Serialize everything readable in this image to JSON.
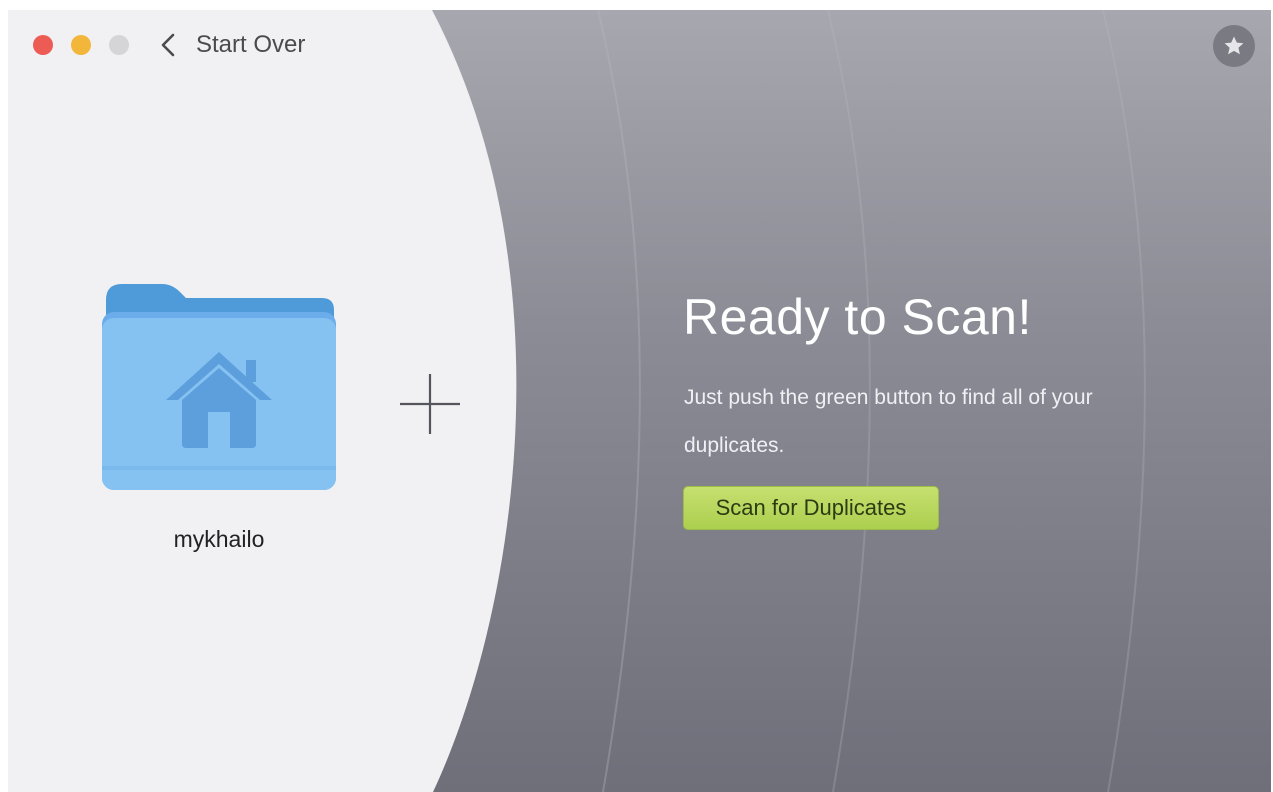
{
  "window": {
    "traffic_lights": [
      "close",
      "minimize",
      "zoom"
    ]
  },
  "toolbar": {
    "back_icon": "chevron-left-icon",
    "start_over_label": "Start Over",
    "star_icon": "star-icon"
  },
  "target": {
    "folder_icon": "home-folder-icon",
    "folder_name": "mykhailo",
    "add_icon": "plus-icon"
  },
  "main": {
    "headline": "Ready to Scan!",
    "subtext": "Just push the green button to find all of your duplicates.",
    "scan_button_label": "Scan for Duplicates"
  },
  "colors": {
    "close": "#ed5b55",
    "minimize": "#f2b63a",
    "zoom_inactive": "#d5d5d8",
    "scan_button": "#b5d65a",
    "folder": "#7dbdf0"
  }
}
